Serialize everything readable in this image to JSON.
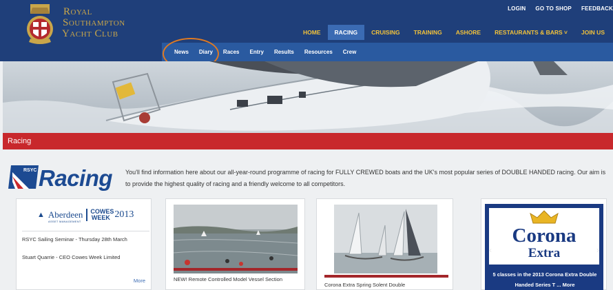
{
  "brand": {
    "line1": "Royal",
    "line2": "Southampton",
    "line3": "Yacht Club"
  },
  "utility_nav": [
    "LOGIN",
    "GO TO SHOP",
    "FEEDBACK"
  ],
  "main_nav": [
    {
      "label": "HOME",
      "active": false
    },
    {
      "label": "RACING",
      "active": true
    },
    {
      "label": "CRUISING",
      "active": false
    },
    {
      "label": "TRAINING",
      "active": false
    },
    {
      "label": "ASHORE",
      "active": false
    },
    {
      "label": "RESTAURANTS & BARS ˅",
      "active": false
    },
    {
      "label": "JOIN US",
      "active": false
    }
  ],
  "sub_nav": [
    "News",
    "Diary",
    "Races",
    "Entry",
    "Results",
    "Resources",
    "Crew"
  ],
  "section_title": "Racing",
  "intro": {
    "logo_small": "RSYC",
    "logo_word": "Racing",
    "text": "You'll find information here about our all-year-round programme of racing for FULLY CREWED boats and the UK's most popular series of DOUBLE HANDED racing. Our aim is to provide the highest quality of racing and a friendly welcome to all competitors."
  },
  "cards": {
    "card1": {
      "sponsor_name": "Aberdeen",
      "sponsor_sub": "ASSET MANAGEMENT",
      "event": "COWES WEEK",
      "event_year": "2013",
      "item1": "RSYC Sailing Seminar - Thursday 28th March",
      "item2": "Stuart Quarrie - CEO Cowes Week Limited",
      "more": "More"
    },
    "card2": {
      "caption": "NEW! Remote Controlled Model Vessel Section"
    },
    "card3": {
      "caption": "Corona Extra Spring Solent Double"
    },
    "card4": {
      "brand": "Corona",
      "brand_sub": "Extra",
      "caption": "5 classes in the 2013 Corona Extra Double Handed Series T ... More"
    }
  },
  "colors": {
    "header": "#1f3f7a",
    "subnav": "#2a5aa0",
    "accent_gold": "#f2c23a",
    "section_red": "#c8282c",
    "highlight_ring": "#e07a22"
  }
}
